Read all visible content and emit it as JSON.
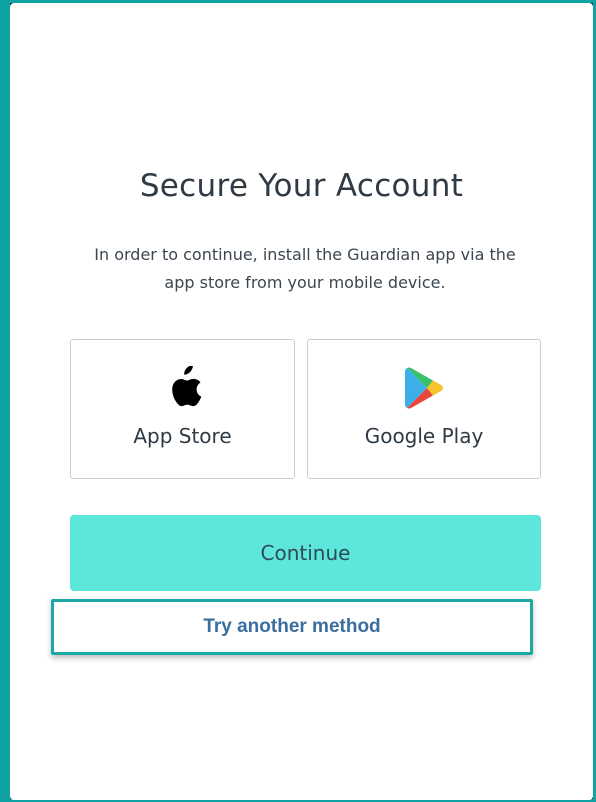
{
  "page": {
    "title": "Secure Your Account",
    "subtitle": "In order to continue, install the Guardian app via the app store from your mobile device."
  },
  "stores": {
    "apple": {
      "label": "App Store",
      "icon": "apple-icon"
    },
    "google": {
      "label": "Google Play",
      "icon": "google-play-icon"
    }
  },
  "actions": {
    "continue_label": "Continue",
    "other_method_label": "Try another method"
  },
  "colors": {
    "accent": "#5de6db",
    "highlight_border": "#1aa8a6",
    "link": "#3a6e9e",
    "background": "#0b1f33"
  }
}
